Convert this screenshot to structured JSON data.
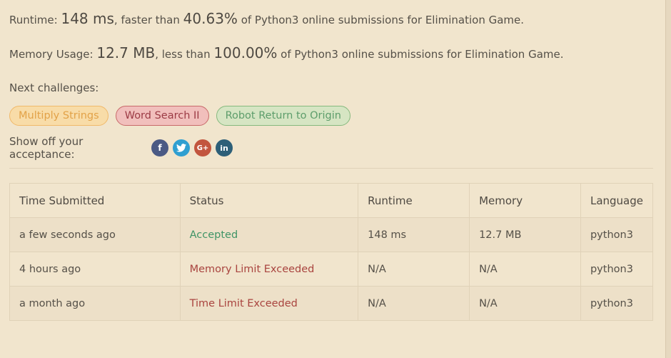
{
  "runtime": {
    "prefix": "Runtime: ",
    "value": "148 ms",
    "middle": ", faster than ",
    "percent": "40.63%",
    "suffix": " of Python3 online submissions for Elimination Game."
  },
  "memory": {
    "prefix": "Memory Usage: ",
    "value": "12.7 MB",
    "middle": ", less than ",
    "percent": "100.00%",
    "suffix": " of Python3 online submissions for Elimination Game."
  },
  "next_challenges": {
    "label": "Next challenges:",
    "items": [
      {
        "label": "Multiply Strings",
        "difficulty": "medium"
      },
      {
        "label": "Word Search II",
        "difficulty": "hard"
      },
      {
        "label": "Robot Return to Origin",
        "difficulty": "easy"
      }
    ]
  },
  "share": {
    "label": "Show off your acceptance:",
    "icons": [
      {
        "name": "facebook-icon",
        "glyph": "f"
      },
      {
        "name": "twitter-icon",
        "glyph": "t"
      },
      {
        "name": "google-plus-icon",
        "glyph": "G+"
      },
      {
        "name": "linkedin-icon",
        "glyph": "in"
      }
    ]
  },
  "table": {
    "headers": [
      "Time Submitted",
      "Status",
      "Runtime",
      "Memory",
      "Language"
    ],
    "rows": [
      {
        "time": "a few seconds ago",
        "status": "Accepted",
        "runtime": "148 ms",
        "memory": "12.7 MB",
        "language": "python3"
      },
      {
        "time": "4 hours ago",
        "status": "Memory Limit Exceeded",
        "runtime": "N/A",
        "memory": "N/A",
        "language": "python3"
      },
      {
        "time": "a month ago",
        "status": "Time Limit Exceeded",
        "runtime": "N/A",
        "memory": "N/A",
        "language": "python3"
      }
    ]
  },
  "colors": {
    "background": "#f1e5cd",
    "accepted": "#3f9466",
    "error": "#a9443f",
    "medium": "#e2a248",
    "hard": "#9c3b45",
    "easy": "#5d9d6b"
  }
}
